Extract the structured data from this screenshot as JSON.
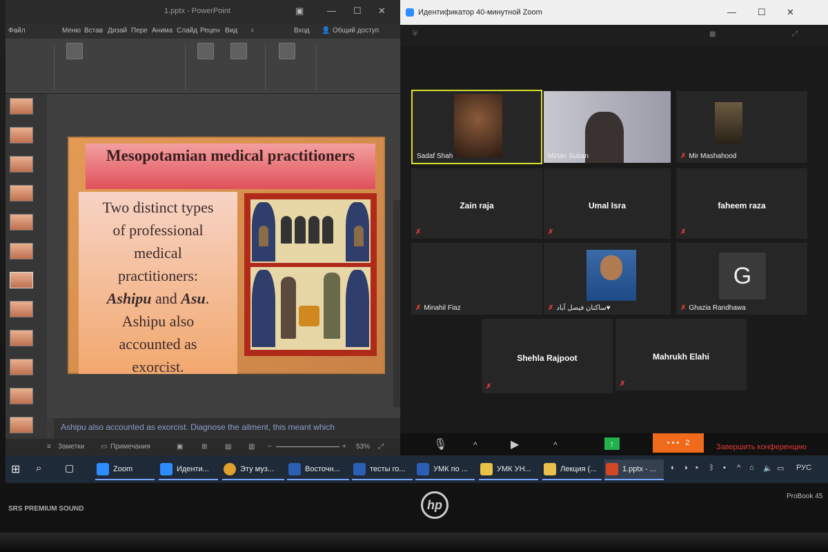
{
  "powerpoint": {
    "title": "1.pptx - PowerPoint",
    "menu": [
      "Файл",
      "Меню",
      "Встав",
      "Дизай",
      "Пере",
      "Анима",
      "Слайд",
      "Рецен",
      "Вид"
    ],
    "sign_in": "Вход",
    "share": "Общий доступ",
    "slide": {
      "title": "Mesopotamian medical practitioners",
      "body_lines": [
        "Two distinct types",
        "of professional",
        "medical",
        "practitioners:"
      ],
      "ashipu": "Ashipu",
      "and": " and ",
      "asu": "Asu",
      "period": ".",
      "body_tail": [
        "Ashipu also",
        "accounted as",
        "exorcist."
      ]
    },
    "notes_text": "Ashipu also accounted as  exorcist. Diagnose the ailment, this meant which",
    "status": {
      "notes": "Заметки",
      "comments": "Примечания",
      "zoom": "53%"
    }
  },
  "zoom": {
    "title": "Идентификатор 40-минутной Zoom",
    "participants": [
      {
        "name": "Sadaf Shah"
      },
      {
        "name": "Mirlan Suban"
      },
      {
        "name": "Mir Mashahood"
      },
      {
        "name": "Zain raja"
      },
      {
        "name": "Umal Isra"
      },
      {
        "name": "faheem raza"
      },
      {
        "name": "Minahil Fiaz"
      },
      {
        "name": "ساکنان فیصل آباد♥"
      },
      {
        "name": "Ghazia Randhawa",
        "initial": "G"
      },
      {
        "name": "Shehla Rajpoot"
      },
      {
        "name": "Mahrukh Elahi"
      }
    ],
    "controls": {
      "more_count": "2",
      "end": "Завершить конференцию"
    }
  },
  "taskbar": {
    "items": [
      {
        "label": "Zoom",
        "color": "#2d8cff"
      },
      {
        "label": "Иденти...",
        "color": "#2d8cff"
      },
      {
        "label": "Эту муз...",
        "color": "#e0a030"
      },
      {
        "label": "Восточн...",
        "color": "#2b5fb4"
      },
      {
        "label": "тесты го...",
        "color": "#2b5fb4"
      },
      {
        "label": "УМК по ...",
        "color": "#2b5fb4"
      },
      {
        "label": "УМК УН...",
        "color": "#e8c04a"
      },
      {
        "label": "Лекция (...",
        "color": "#e8c04a"
      },
      {
        "label": "1.pptx - ...",
        "color": "#d24726"
      }
    ],
    "lang": "РУС"
  },
  "laptop": {
    "brand": "hp",
    "audio": "SRS PREMIUM SOUND",
    "model": "ProBook 45"
  }
}
